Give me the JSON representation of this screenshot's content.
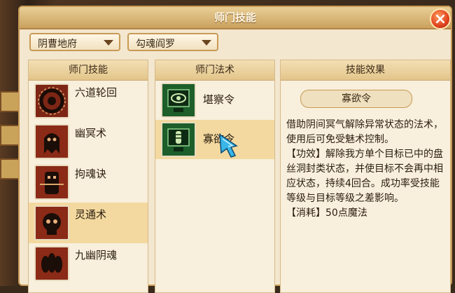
{
  "window": {
    "title": "师门技能",
    "close_label": "×"
  },
  "filters": [
    {
      "value": "阴曹地府"
    },
    {
      "value": "勾魂阎罗"
    }
  ],
  "columns": {
    "skills_header": "师门技能",
    "spells_header": "师门法术",
    "effect_header": "技能效果"
  },
  "skills": [
    {
      "label": "六道轮回",
      "icon": "wheel-icon"
    },
    {
      "label": "幽冥术",
      "icon": "ghost-icon"
    },
    {
      "label": "拘魂诀",
      "icon": "ghost-chain-icon"
    },
    {
      "label": "灵通术",
      "icon": "skull-icon",
      "selected": true
    },
    {
      "label": "九幽阴魂",
      "icon": "spirits-icon"
    }
  ],
  "spells": [
    {
      "label": "堪察令",
      "icon": "eye-tablet-icon"
    },
    {
      "label": "寡欲令",
      "icon": "seal-tablet-icon",
      "selected": true
    }
  ],
  "effect": {
    "name": "寡欲令",
    "description": "借助阴间冥气解除异常状态的法术，使用后可免受魅术控制。\n【功效】解除我方单个目标已中的盘丝洞封类状态，并使目标不会再中相应状态，持续4回合。成功率受技能等级与目标等级之差影响。\n【消耗】50点魔法"
  },
  "colors": {
    "panel": "#f3e7cf",
    "border": "#c89a55",
    "selected_row": "#f3d99f",
    "close_button": "#e0431f"
  }
}
